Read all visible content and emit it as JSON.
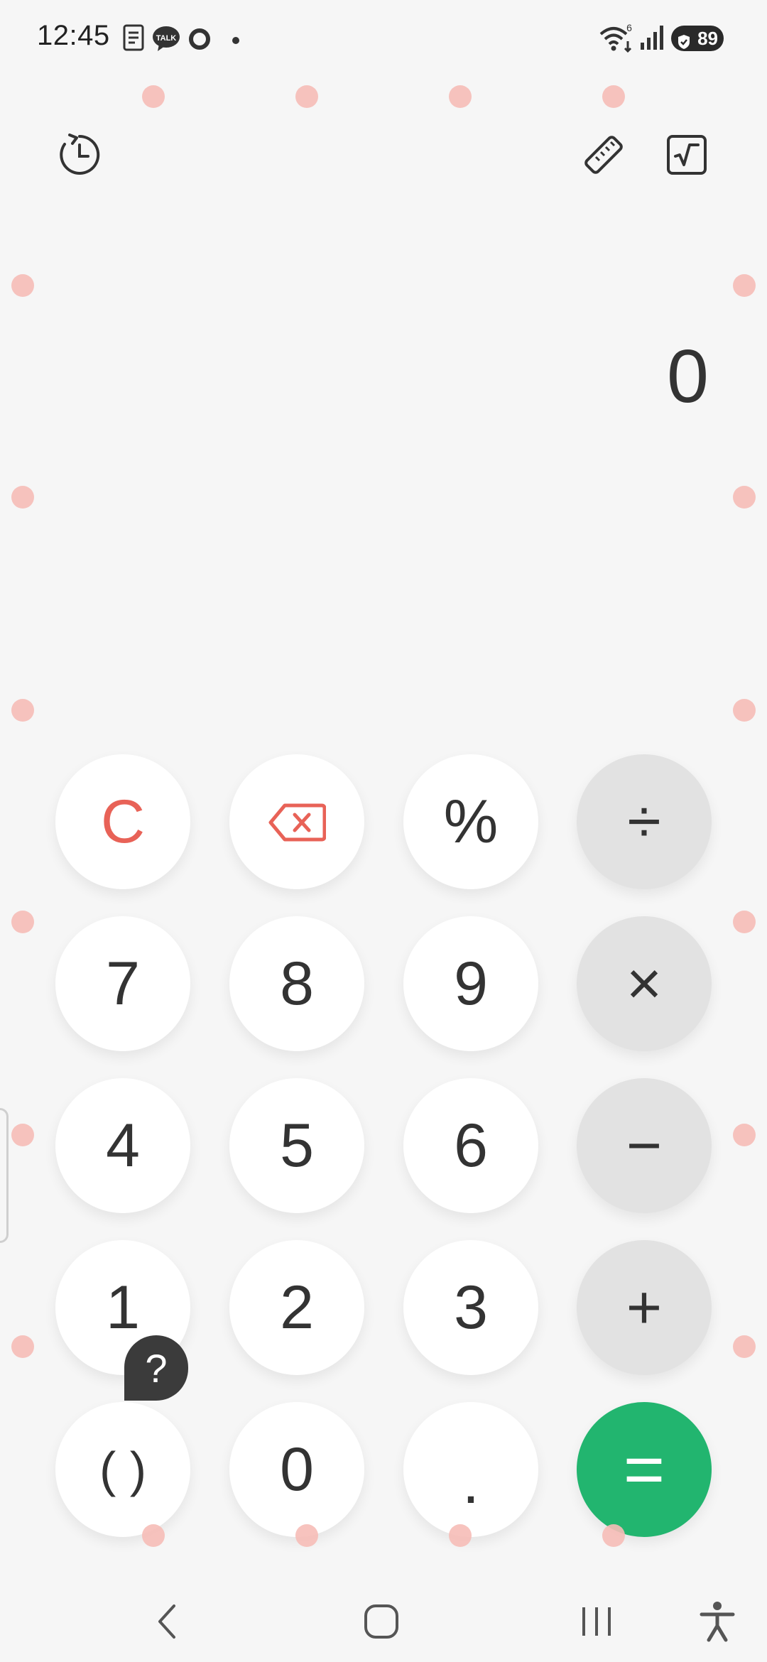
{
  "status_bar": {
    "time": "12:45",
    "icons": [
      "document-icon",
      "talk-icon",
      "circle-icon",
      "dot-icon"
    ],
    "talk_label": "TALK",
    "network": "6",
    "battery": "89"
  },
  "toolbar": {
    "history_icon": "history-icon",
    "unit_converter_icon": "ruler-icon",
    "scientific_icon": "sqrt-icon"
  },
  "display": {
    "value": "0"
  },
  "keypad": {
    "row1": [
      "C",
      "⌫",
      "%",
      "÷"
    ],
    "row2": [
      "7",
      "8",
      "9",
      "×"
    ],
    "row3": [
      "4",
      "5",
      "6",
      "−"
    ],
    "row4": [
      "1",
      "2",
      "3",
      "+"
    ],
    "row5": [
      "( )",
      "0",
      ".",
      "="
    ]
  },
  "help": {
    "label": "?"
  },
  "colors": {
    "clear_key": "#e86257",
    "equals_key": "#22b56f",
    "operator_key": "#e2e2e2",
    "digit_key": "#ffffff",
    "background": "#f6f6f6"
  },
  "nav": {
    "back_icon": "back-icon",
    "home_icon": "home-icon",
    "recents_icon": "recents-icon",
    "accessibility_icon": "accessibility-icon"
  }
}
